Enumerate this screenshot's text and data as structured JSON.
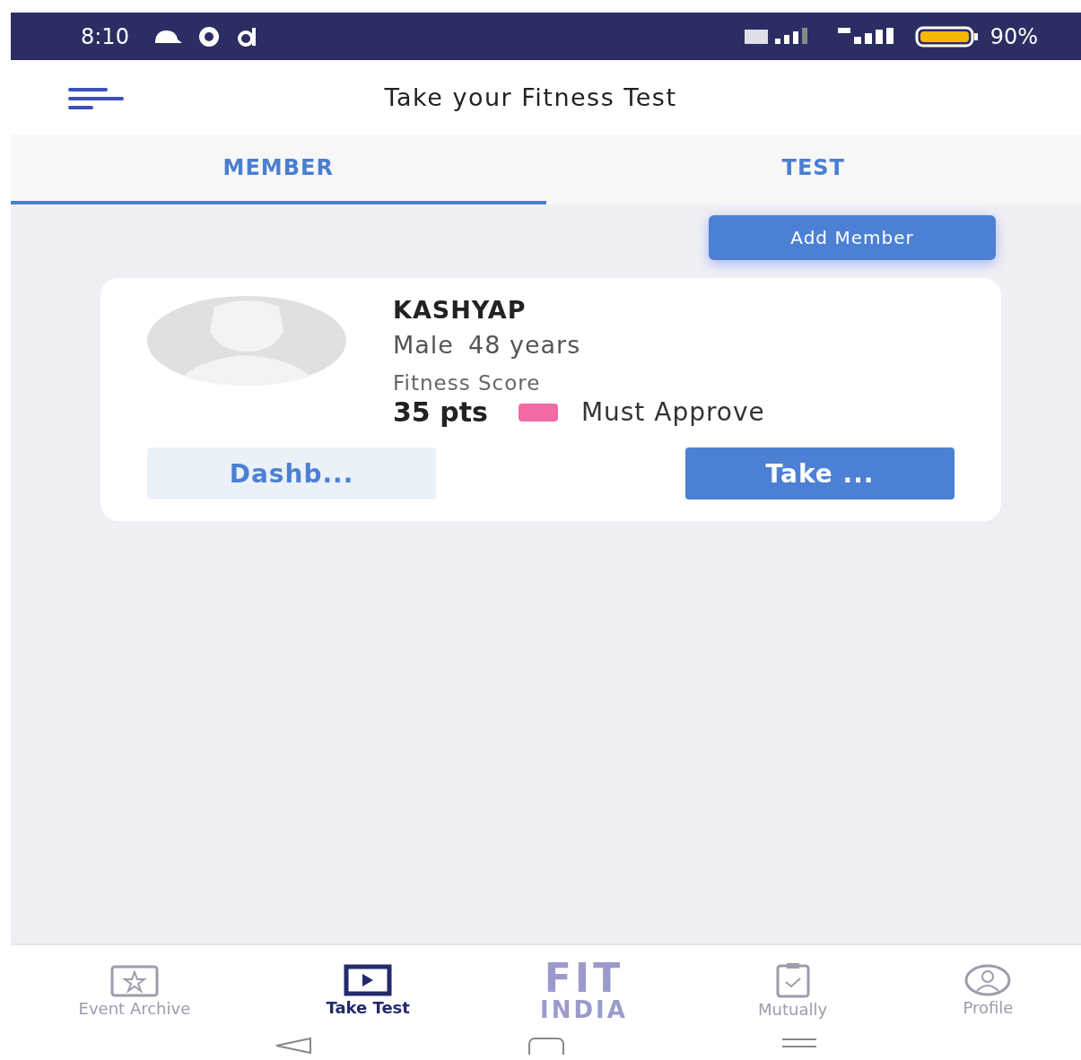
{
  "status_bar": {
    "time": "8:10",
    "battery": "90%"
  },
  "header": {
    "title": "Take your Fitness Test"
  },
  "tabs": [
    {
      "label": "MEMBER",
      "selected": true
    },
    {
      "label": "TEST",
      "selected": false
    }
  ],
  "add_button": "Add Member",
  "members": [
    {
      "name": "KASHYAP",
      "gender": "Male",
      "age": "48 years",
      "score_label": "Fitness Score",
      "score": "35 pts",
      "status": "Must Approve",
      "color": "#f26aa6",
      "dashboard_button": "Dashb...",
      "take_button": "Take ..."
    }
  ],
  "bottom_nav": [
    {
      "kind": "archive",
      "label": "Event Archive",
      "selected": false
    },
    {
      "kind": "play",
      "label": "Take Test",
      "selected": true
    },
    {
      "kind": "logo",
      "top": "FIT",
      "bottom": "INDIA"
    },
    {
      "kind": "clipboard",
      "label": "Mutually",
      "selected": false
    },
    {
      "kind": "profile",
      "label": "Profile",
      "selected": false
    }
  ]
}
